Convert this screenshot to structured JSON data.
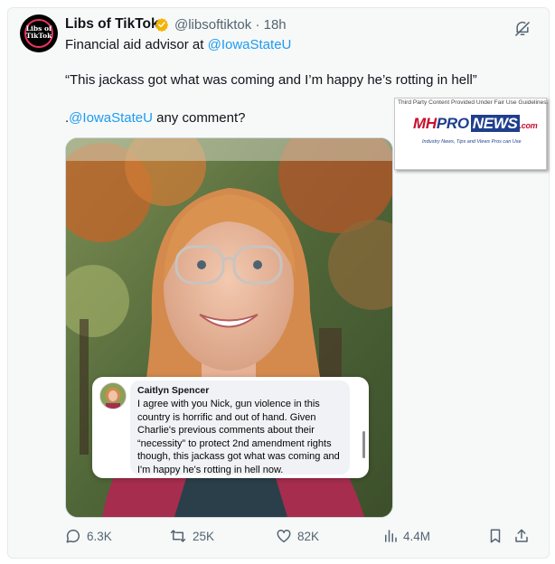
{
  "post": {
    "author_name": "Libs of TikTok",
    "avatar_text": "Libs of TikTok",
    "handle": "@libsoftiktok",
    "separator": "·",
    "time": "18h",
    "line1_prefix": "Financial aid advisor at ",
    "line1_link": "@IowaStateU",
    "quote": "“This jackass got what was coming and I’m happy he’s rotting in hell”",
    "comment_prefix": ".",
    "comment_link": "@IowaStateU",
    "comment_suffix": " any comment?"
  },
  "watermark": {
    "caption": "Third Party Content Provided Under Fair Use Guidelines.",
    "logo_mh": "MH",
    "logo_pro": "PRO",
    "logo_news": "NEWS",
    "logo_com": ".com",
    "tagline": "Industry News, Tips and Views Pros can Use"
  },
  "popup": {
    "commenter_name": "Caitlyn Spencer",
    "comment_text": "I agree with you Nick, gun violence in this country is horrific and out of hand. Given Charlie's previous comments about their “necessity” to protect 2nd amendment rights though, this jackass got what was coming and I'm happy he's rotting in hell now."
  },
  "actions": {
    "replies": "6.3K",
    "reposts": "25K",
    "likes": "82K",
    "views": "4.4M"
  },
  "colors": {
    "link": "#1d9bf0",
    "verified": "#f4b400",
    "muted_text": "#536471"
  },
  "icons": [
    "verified-badge-icon",
    "mute-icon",
    "reply-icon",
    "repost-icon",
    "like-icon",
    "views-icon",
    "bookmark-icon",
    "share-icon"
  ]
}
